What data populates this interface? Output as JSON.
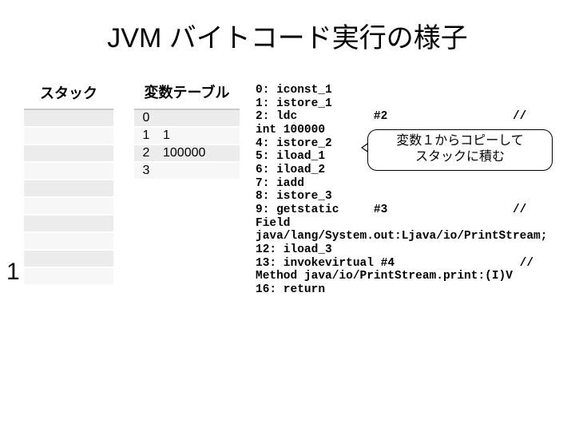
{
  "title": "JVM バイトコード実行の様子",
  "stack": {
    "header": "スタック",
    "rows": [
      "",
      "",
      "",
      "",
      "",
      "",
      "",
      "",
      "",
      ""
    ]
  },
  "push_value": "1",
  "vartable": {
    "header": "変数テーブル",
    "rows": [
      {
        "idx": "0",
        "val": ""
      },
      {
        "idx": "1",
        "val": "1"
      },
      {
        "idx": "2",
        "val": "100000"
      },
      {
        "idx": "3",
        "val": ""
      }
    ]
  },
  "callout": {
    "line1": "変数１からコピーして",
    "line2": "スタックに積む"
  },
  "code_lines": [
    "0: iconst_1",
    "1: istore_1",
    "2: ldc           #2                  //",
    "int 100000",
    "4: istore_2",
    "5: iload_1",
    "6: iload_2",
    "7: iadd",
    "8: istore_3",
    "9: getstatic     #3                  //",
    "Field",
    "java/lang/System.out:Ljava/io/PrintStream;",
    "12: iload_3",
    "13: invokevirtual #4                  //",
    "Method java/io/PrintStream.print:(I)V",
    "16: return"
  ]
}
